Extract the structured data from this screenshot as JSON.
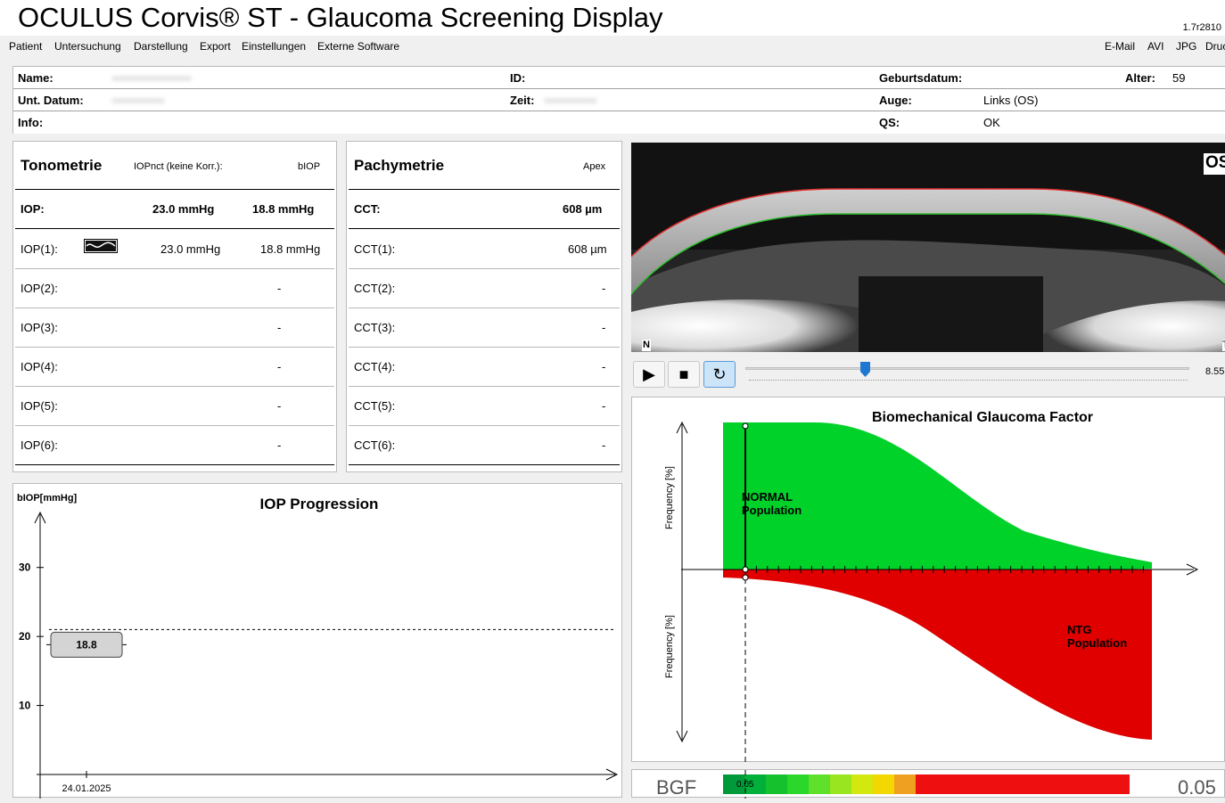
{
  "app": {
    "title": "OCULUS Corvis® ST - Glaucoma Screening Display",
    "version": "1.7r2810"
  },
  "menu": {
    "left": [
      "Patient",
      "Untersuchung",
      "Darstellung",
      "Export",
      "Einstellungen",
      "Externe Software"
    ],
    "right": [
      "E-Mail",
      "AVI",
      "JPG",
      "Druc"
    ]
  },
  "patient": {
    "name_label": "Name:",
    "id_label": "ID:",
    "birth_label": "Geburtsdatum:",
    "age_label": "Alter:",
    "age_value": "59",
    "date_label": "Unt. Datum:",
    "time_label": "Zeit:",
    "eye_label": "Auge:",
    "eye_value": "Links (OS)",
    "info_label": "Info:",
    "qs_label": "QS:",
    "qs_value": "OK"
  },
  "tonometry": {
    "title": "Tonometrie",
    "col1": "IOPnct (keine Korr.):",
    "col2": "bIOP",
    "main": {
      "label": "IOP:",
      "iop": "23.0 mmHg",
      "biop": "18.8 mmHg"
    },
    "rows": [
      {
        "label": "IOP(1):",
        "iop": "23.0 mmHg",
        "biop": "18.8 mmHg"
      },
      {
        "label": "IOP(2):",
        "iop": "",
        "biop": "-"
      },
      {
        "label": "IOP(3):",
        "iop": "",
        "biop": "-"
      },
      {
        "label": "IOP(4):",
        "iop": "",
        "biop": "-"
      },
      {
        "label": "IOP(5):",
        "iop": "",
        "biop": "-"
      },
      {
        "label": "IOP(6):",
        "iop": "",
        "biop": "-"
      }
    ]
  },
  "pachymetry": {
    "title": "Pachymetrie",
    "col1": "Apex",
    "main": {
      "label": "CCT:",
      "value": "608 µm"
    },
    "rows": [
      {
        "label": "CCT(1):",
        "value": "608 µm"
      },
      {
        "label": "CCT(2):",
        "value": "-"
      },
      {
        "label": "CCT(3):",
        "value": "-"
      },
      {
        "label": "CCT(4):",
        "value": "-"
      },
      {
        "label": "CCT(5):",
        "value": "-"
      },
      {
        "label": "CCT(6):",
        "value": "-"
      }
    ]
  },
  "scheimpflug": {
    "eye_tag": "OS",
    "nasal_tag": "N",
    "temporal_tag": "T",
    "time_readout": "8.55",
    "slider_fraction": 0.27
  },
  "colors": {
    "normal": "#00d22a",
    "ntg": "#e00000",
    "selected_button": "#cce4f7",
    "slider": "#1e78d2"
  },
  "bgf": {
    "title": "Biomechanical Glaucoma Factor",
    "ylabel_top": "Frequency [%]",
    "ylabel_bottom": "Frequency [%]",
    "normal_label_1": "NORMAL",
    "normal_label_2": "Population",
    "ntg_label_1": "NTG",
    "ntg_label_2": "Population",
    "bar_label": "BGF",
    "value": "0.05",
    "marker_value": "0.05"
  },
  "chart_data": {
    "type": "scatter",
    "title": "IOP Progression",
    "ylabel": "bIOP[mmHg]",
    "ylim": [
      0,
      35
    ],
    "y_ticks": [
      "30",
      "20",
      "10"
    ],
    "points": [
      {
        "x": "24.01.2025",
        "y": 18.8,
        "label": "18.8"
      }
    ],
    "reference_line": 21,
    "grid": false
  }
}
